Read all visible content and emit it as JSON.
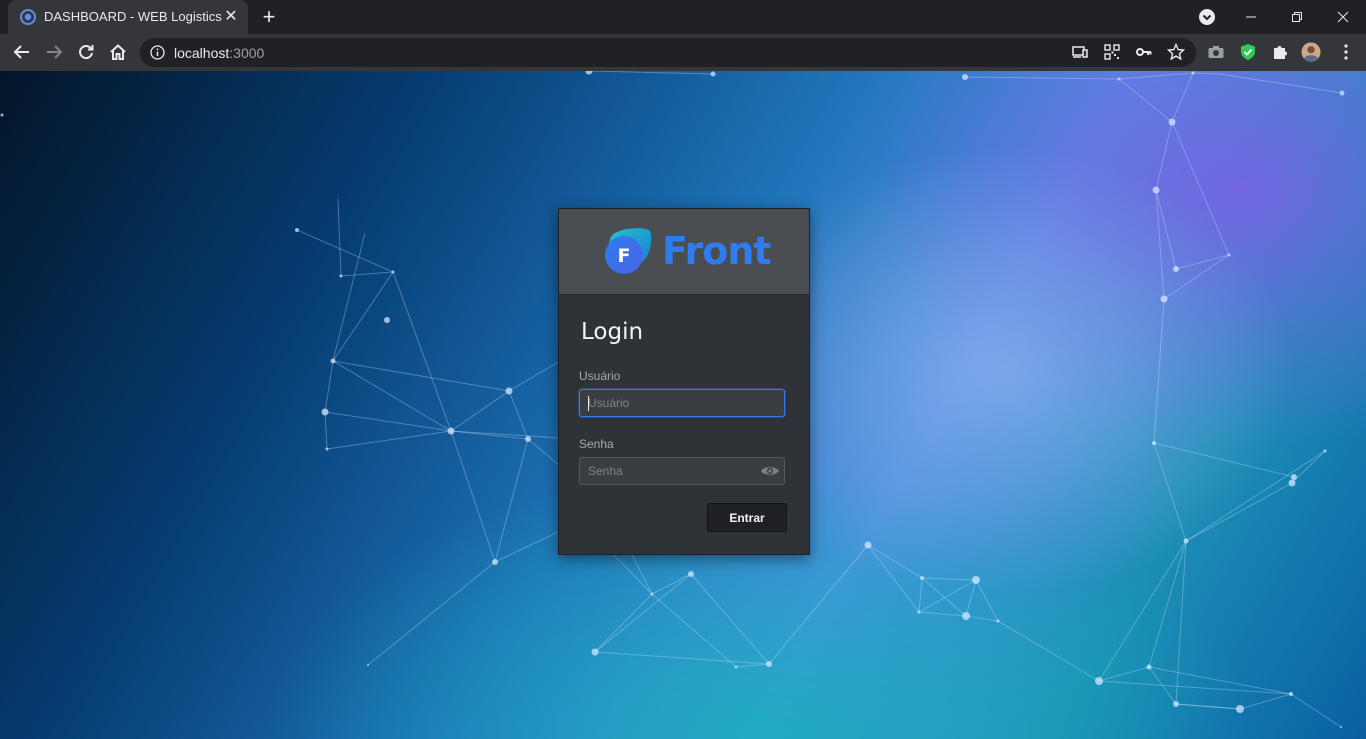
{
  "browser": {
    "tab_title": "DASHBOARD - WEB Logistics",
    "url_host": "localhost",
    "url_port": ":3000"
  },
  "icons": {
    "tab_favicon": "front-favicon-icon",
    "tab_close": "close-icon",
    "new_tab": "plus-icon",
    "tab_search": "chevron-down-icon",
    "back": "arrow-left-icon",
    "forward": "arrow-right-icon",
    "reload": "reload-icon",
    "home": "home-icon",
    "site_info": "info-icon",
    "cast": "cast-icon",
    "qr": "qr-code-icon",
    "key": "key-icon",
    "bookmark": "star-icon",
    "screenshot": "camera-icon",
    "shield": "shield-icon",
    "extensions": "puzzle-icon",
    "profile": "avatar",
    "menu": "kebab-menu-icon",
    "password_toggle": "eye-icon"
  },
  "login": {
    "brand": "Front",
    "title": "Login",
    "user_label": "Usuário",
    "user_placeholder": "Usuário",
    "password_label": "Senha",
    "password_placeholder": "Senha",
    "submit_label": "Entrar"
  },
  "colors": {
    "brand_blue": "#2f7cf0",
    "card_bg": "#2f3236",
    "card_header_bg": "#4a4e53",
    "button_bg": "#1f2124"
  }
}
